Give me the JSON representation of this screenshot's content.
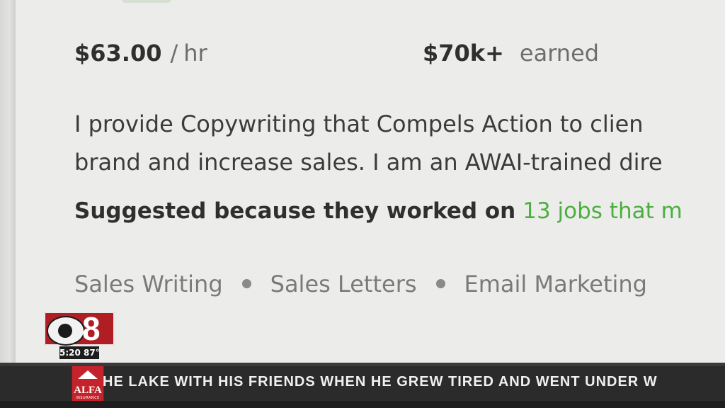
{
  "profile": {
    "rate_amount": "$63.00",
    "rate_separator": "/",
    "rate_unit": "hr",
    "earned_amount": "$70k+",
    "earned_label": "earned",
    "description_lines": [
      "I provide Copywriting that Compels Action to clien",
      "brand and increase sales. I am an AWAI-trained dire"
    ],
    "suggested_prefix": "Suggested because they worked on",
    "suggested_link": "13 jobs that m",
    "skills": [
      "Sales Writing",
      "Sales Letters",
      "Email Marketing"
    ]
  },
  "overlay": {
    "channel_number": "8",
    "time_temp": "5:20 87°",
    "sponsor_name": "ALFA",
    "sponsor_sub": "INSURANCE",
    "ticker_text": "HE LAKE WITH HIS FRIENDS WHEN HE GREW TIRED AND WENT UNDER W"
  },
  "colors": {
    "background": "#ececea",
    "link_green": "#4caf3f",
    "channel_red": "#b01e23",
    "ticker_bg": "#2b2b2b"
  }
}
